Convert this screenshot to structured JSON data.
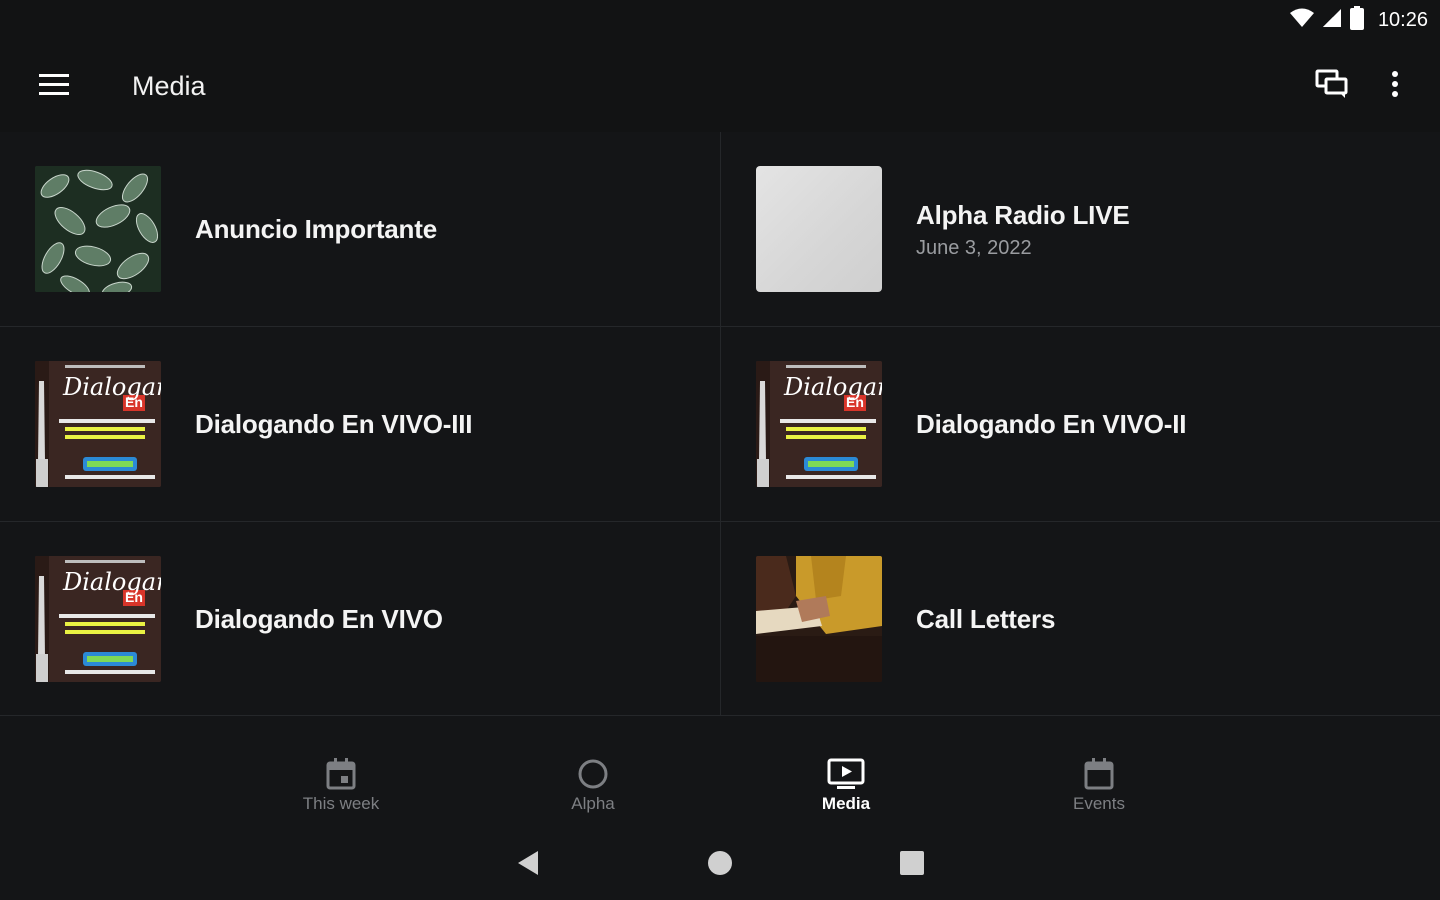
{
  "status_bar": {
    "time": "10:26"
  },
  "app_bar": {
    "title": "Media"
  },
  "media_items": [
    {
      "title": "Anuncio Importante",
      "subtitle": "",
      "thumbnail": "leaves"
    },
    {
      "title": "Alpha Radio LIVE",
      "subtitle": "June 3, 2022",
      "thumbnail": "white-texture"
    },
    {
      "title": "Dialogando En VIVO-III",
      "subtitle": "",
      "thumbnail": "dialogando-poster"
    },
    {
      "title": "Dialogando En VIVO-II",
      "subtitle": "",
      "thumbnail": "dialogando-poster"
    },
    {
      "title": "Dialogando En VIVO",
      "subtitle": "",
      "thumbnail": "dialogando-poster"
    },
    {
      "title": "Call Letters",
      "subtitle": "",
      "thumbnail": "person-reading"
    }
  ],
  "poster_text": {
    "script": "Dialogar",
    "badge": "En"
  },
  "bottom_nav": [
    {
      "label": "This week",
      "icon": "calendar-today-icon",
      "active": false
    },
    {
      "label": "Alpha",
      "icon": "circle-icon",
      "active": false
    },
    {
      "label": "Media",
      "icon": "tv-play-icon",
      "active": true
    },
    {
      "label": "Events",
      "icon": "calendar-icon",
      "active": false
    }
  ],
  "colors": {
    "background": "#141517",
    "bar": "#121314",
    "divider": "#25272a",
    "inactive": "#7d7f83",
    "active": "#ffffff",
    "subtitle": "#9a9ca0"
  }
}
